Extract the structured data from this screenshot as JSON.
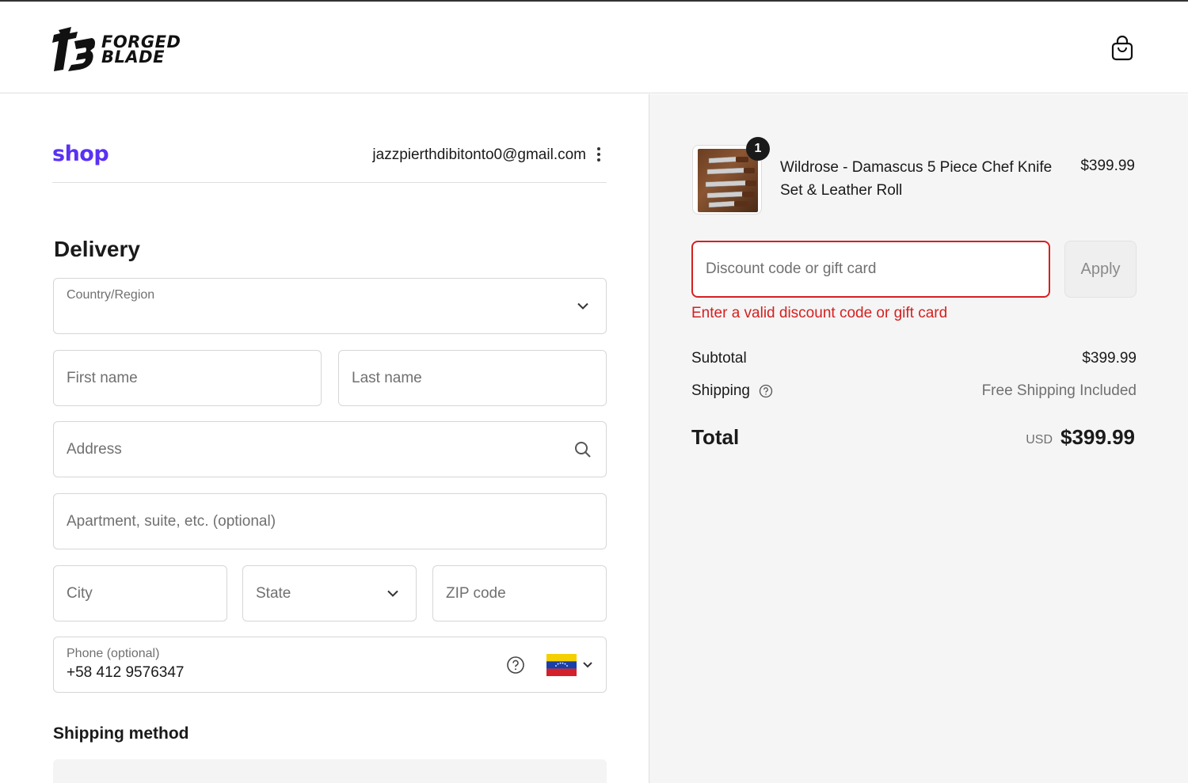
{
  "brand": {
    "line1": "FORGED",
    "line2": "BLADE"
  },
  "shop_pay": {
    "logo_text": "shop",
    "email": "jazzpierthdibitonto0@gmail.com"
  },
  "delivery": {
    "heading": "Delivery",
    "country_label": "Country/Region",
    "country_value": "",
    "first_name_placeholder": "First name",
    "last_name_placeholder": "Last name",
    "address_placeholder": "Address",
    "apartment_placeholder": "Apartment, suite, etc. (optional)",
    "city_placeholder": "City",
    "state_placeholder": "State",
    "zip_placeholder": "ZIP code",
    "phone_label": "Phone (optional)",
    "phone_value": "+58 412 9576347",
    "phone_country_flag": "venezuela-flag"
  },
  "shipping_method": {
    "heading": "Shipping method"
  },
  "cart": {
    "item_count": "1",
    "product_name": "Wildrose - Damascus 5 Piece Chef Knife Set & Leather Roll",
    "product_price": "$399.99"
  },
  "discount": {
    "placeholder": "Discount code or gift card",
    "apply_label": "Apply",
    "error_text": "Enter a valid discount code or gift card",
    "error_color": "#d61f1f"
  },
  "summary": {
    "subtotal_label": "Subtotal",
    "subtotal_value": "$399.99",
    "shipping_label": "Shipping",
    "shipping_value": "Free Shipping Included",
    "total_label": "Total",
    "currency": "USD",
    "total_value": "$399.99"
  },
  "colors": {
    "shop_purple": "#5a31f4",
    "error_red": "#d61f1f"
  }
}
